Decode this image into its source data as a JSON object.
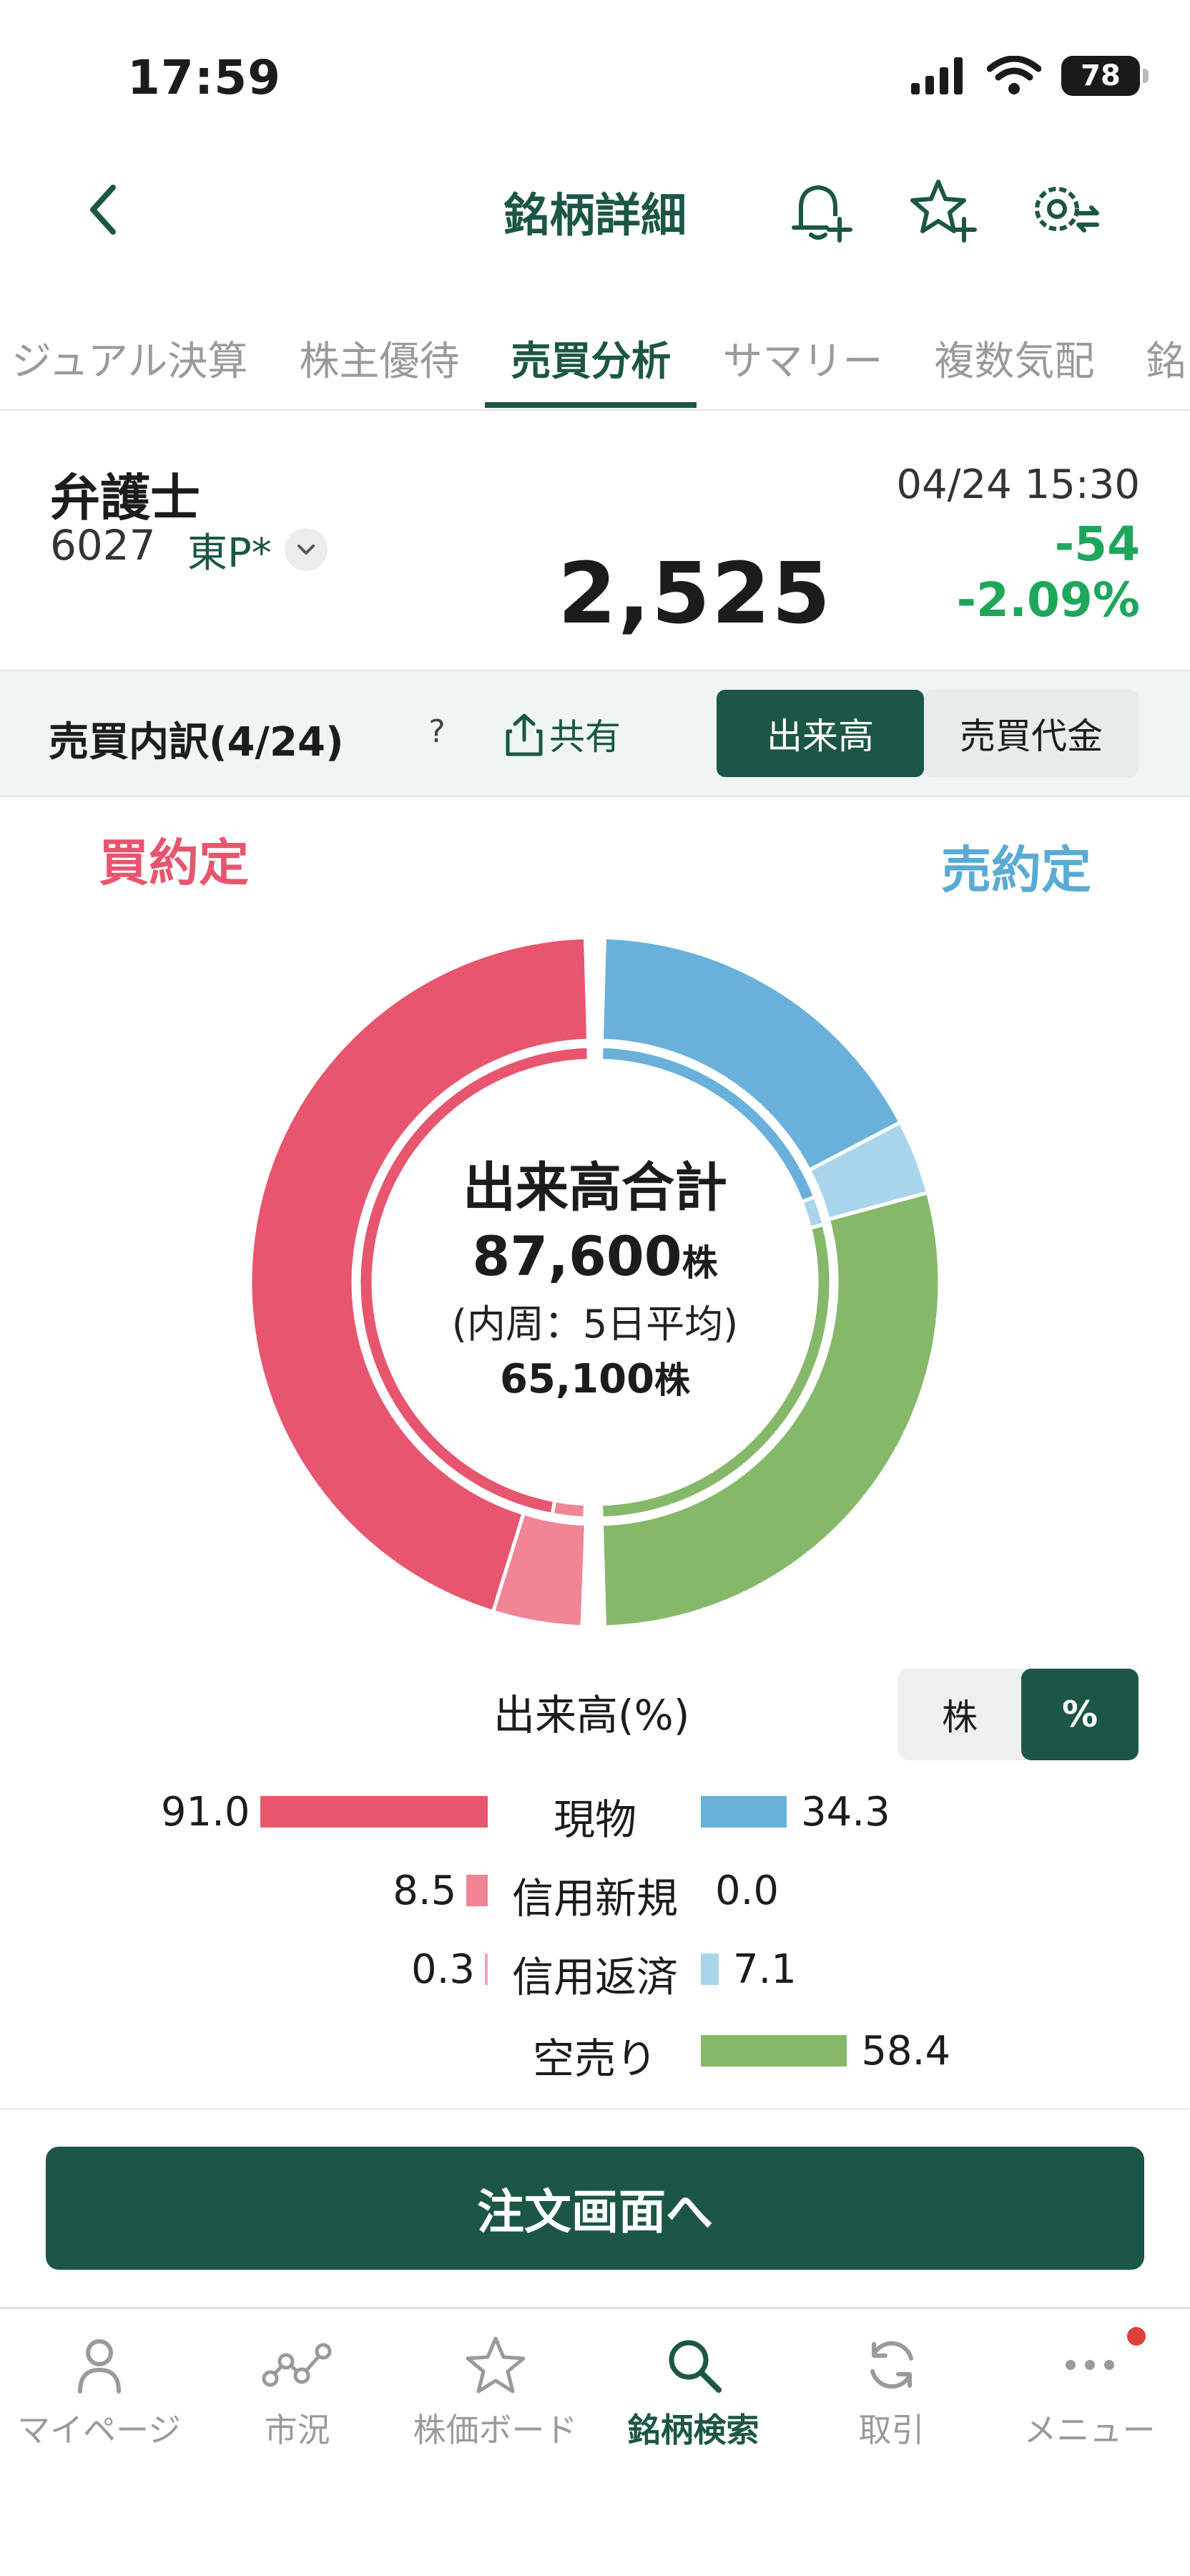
{
  "status_bar": {
    "time": "17:59",
    "battery": "78"
  },
  "header": {
    "title": "銘柄詳細"
  },
  "tabs": [
    {
      "label": "ジュアル決算",
      "active": false
    },
    {
      "label": "株主優待",
      "active": false
    },
    {
      "label": "売買分析",
      "active": true
    },
    {
      "label": "サマリー",
      "active": false
    },
    {
      "label": "複数気配",
      "active": false
    },
    {
      "label": "銘",
      "active": false
    }
  ],
  "stock": {
    "name": "弁護士",
    "code": "6027",
    "market": "東P*",
    "datetime": "04/24 15:30",
    "price": "2,525",
    "change": "-54",
    "change_pct": "-2.09%"
  },
  "breakdown": {
    "title": "売買内訳(4/24)",
    "help": "?",
    "share": "共有",
    "segments": {
      "volume": "出来高",
      "value": "売買代金"
    }
  },
  "chart_labels": {
    "buy": "買約定",
    "sell": "売約定"
  },
  "center": {
    "title": "出来高合計",
    "total": "87,600",
    "unit": "株",
    "inner_note": "(内周：5日平均)",
    "avg": "65,100"
  },
  "colors": {
    "accent": "#1b5646",
    "buy_spot": "#e8556e",
    "buy_margin_new": "#f08596",
    "buy_margin_repay": "#f2a3b1",
    "sell_spot": "#69b1da",
    "sell_margin_repay": "#a9d5ec",
    "sell_short": "#86b86a",
    "up_green": "#1ea65b"
  },
  "volume_section": {
    "label": "出来高(%)",
    "toggle_shares": "株",
    "toggle_pct": "%"
  },
  "chart_data": {
    "type": "pie",
    "outer": {
      "buy": [
        {
          "name": "現物",
          "value": 91.0
        },
        {
          "name": "信用新規",
          "value": 8.5
        },
        {
          "name": "信用返済",
          "value": 0.3
        }
      ],
      "sell": [
        {
          "name": "現物",
          "value": 34.3
        },
        {
          "name": "信用返済",
          "value": 7.1
        },
        {
          "name": "空売り",
          "value": 58.4
        }
      ]
    },
    "inner": {
      "buy": [
        {
          "name": "現物",
          "value": 95.0
        },
        {
          "name": "信用新規",
          "value": 4.5
        },
        {
          "name": "信用返済",
          "value": 0.5
        }
      ],
      "sell": [
        {
          "name": "現物",
          "value": 38.0
        },
        {
          "name": "信用返済",
          "value": 4.0
        },
        {
          "name": "空売り",
          "value": 58.0
        }
      ]
    }
  },
  "rows": [
    {
      "label": "現物",
      "buy": "91.0",
      "sell": "34.3"
    },
    {
      "label": "信用新規",
      "buy": "8.5",
      "sell": "0.0"
    },
    {
      "label": "信用返済",
      "buy": "0.3",
      "sell": "7.1"
    },
    {
      "label": "空売り",
      "buy": "",
      "sell": "58.4"
    }
  ],
  "order_button": "注文画面へ",
  "nav": [
    {
      "label": "マイページ",
      "icon": "person-icon"
    },
    {
      "label": "市況",
      "icon": "market-graph-icon"
    },
    {
      "label": "株価ボード",
      "icon": "star-icon"
    },
    {
      "label": "銘柄検索",
      "icon": "search-icon"
    },
    {
      "label": "取引",
      "icon": "refresh-icon"
    },
    {
      "label": "メニュー",
      "icon": "more-icon"
    }
  ]
}
